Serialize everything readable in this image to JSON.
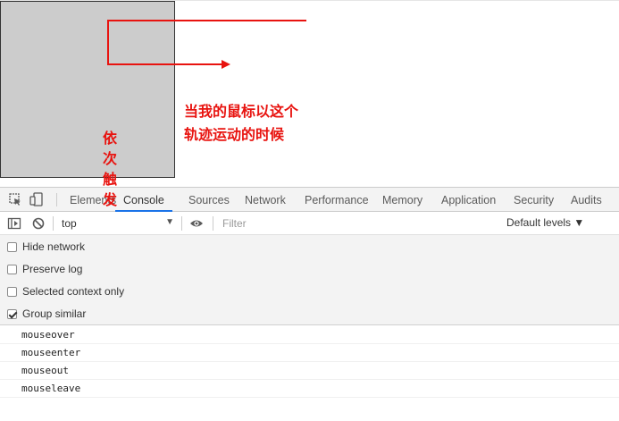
{
  "annotation": {
    "line1": "当我的鼠标以这个",
    "line2": "轨迹运动的时候",
    "vertical": [
      "依",
      "次",
      "触",
      "发"
    ]
  },
  "devtools": {
    "tabs": [
      "Elements",
      "Console",
      "Sources",
      "Network",
      "Performance",
      "Memory",
      "Application",
      "Security",
      "Audits"
    ],
    "active_tab": "Console",
    "context": "top",
    "filter_placeholder": "Filter",
    "levels": "Default levels ▼",
    "settings": [
      {
        "label": "Hide network",
        "checked": false
      },
      {
        "label": "Preserve log",
        "checked": false
      },
      {
        "label": "Selected context only",
        "checked": false
      },
      {
        "label": "Group similar",
        "checked": true
      }
    ],
    "messages": [
      "mouseover",
      "mouseenter",
      "mouseout",
      "mouseleave"
    ]
  },
  "colors": {
    "annotation_red": "#e8130f",
    "box_gray": "#cccccc",
    "active_tab_underline": "#1a73e8"
  },
  "icons": [
    "inspect-element-icon",
    "device-toolbar-icon",
    "sidebar-toggle-icon",
    "clear-console-icon",
    "eye-icon",
    "dropdown-arrow-icon"
  ]
}
